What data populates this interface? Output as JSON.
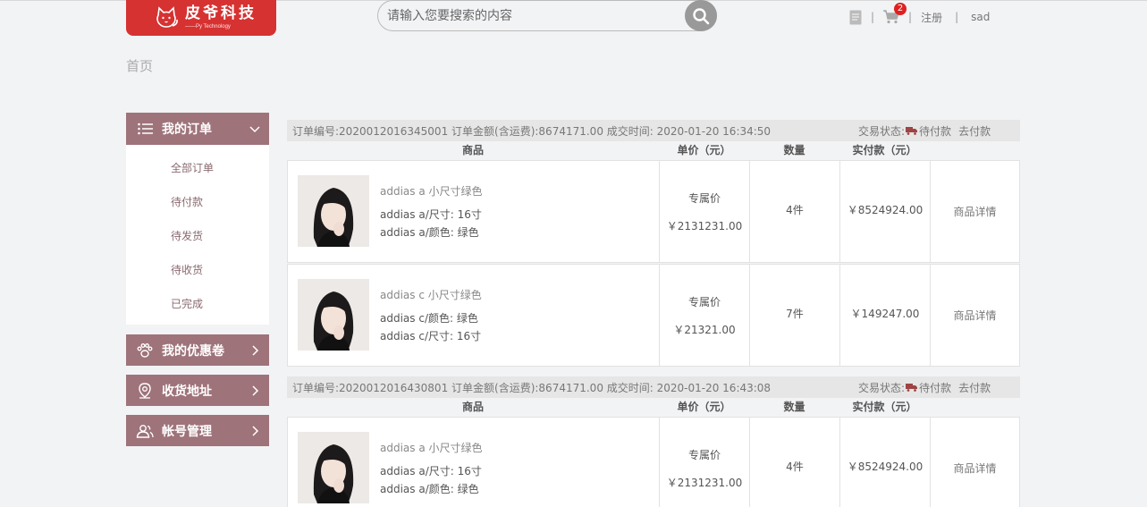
{
  "header": {
    "logo_brand": "皮爷科技",
    "logo_sub": "——Py Technology",
    "search_placeholder": "请输入您要搜索的内容",
    "cart_count": "2",
    "register": "注册",
    "username": "sad"
  },
  "breadcrumb": "首页",
  "sidebar": {
    "orders_title": "我的订单",
    "order_items": [
      "全部订单",
      "待付款",
      "待发货",
      "待收货",
      "已完成"
    ],
    "coupons": "我的优惠卷",
    "address": "收货地址",
    "account": "帐号管理"
  },
  "columns": {
    "goods": "商品",
    "unit_price": "单价（元）",
    "qty": "数量",
    "paid": "实付款（元）"
  },
  "orders": [
    {
      "header": "订单编号:2020012016345001 订单金额(含运费):8674171.00 成交时间: 2020-01-20 16:34:50",
      "status_label": "交易状态:",
      "status": "待付款",
      "action": "去付款",
      "items": [
        {
          "name": "addias a 小尺寸绿色",
          "attr1": "addias a/尺寸: 16寸",
          "attr2": "addias a/颜色: 绿色",
          "price_label": "专属价",
          "price": "￥2131231.00",
          "qty": "4件",
          "paid": "￥8524924.00",
          "detail": "商品详情"
        },
        {
          "name": "addias c 小尺寸绿色",
          "attr1": "addias c/颜色: 绿色",
          "attr2": "addias c/尺寸: 16寸",
          "price_label": "专属价",
          "price": "￥21321.00",
          "qty": "7件",
          "paid": "￥149247.00",
          "detail": "商品详情"
        }
      ]
    },
    {
      "header": "订单编号:2020012016430801 订单金额(含运费):8674171.00 成交时间: 2020-01-20 16:43:08",
      "status_label": "交易状态:",
      "status": "待付款",
      "action": "去付款",
      "items": [
        {
          "name": "addias a 小尺寸绿色",
          "attr1": "addias a/尺寸: 16寸",
          "attr2": "addias a/颜色: 绿色",
          "price_label": "专属价",
          "price": "￥2131231.00",
          "qty": "4件",
          "paid": "￥8524924.00",
          "detail": "商品详情"
        }
      ]
    }
  ],
  "colors": {
    "accent": "#9e737a",
    "logo_red": "#d63232",
    "badge": "#e02020"
  }
}
